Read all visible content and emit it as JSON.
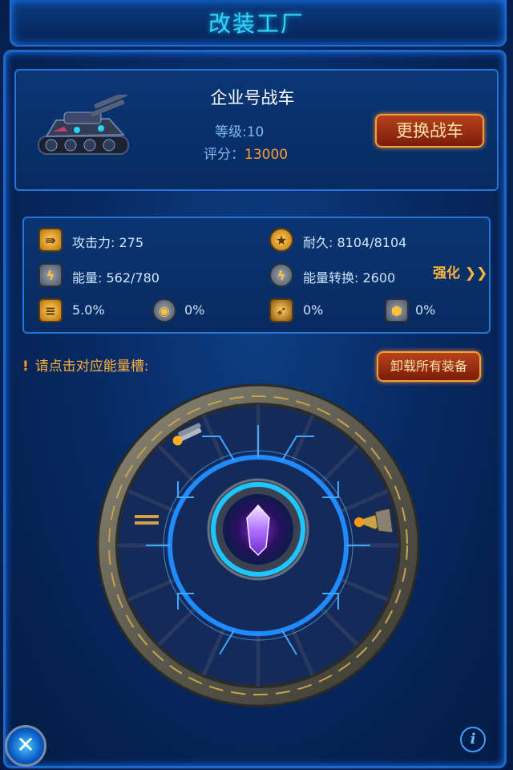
{
  "header": {
    "title": "改装工厂"
  },
  "vehicle": {
    "name": "企业号战车",
    "level_label": "等级:",
    "level_value": "10",
    "score_label": "评分：",
    "score_value": "13000",
    "change_button": "更换战车"
  },
  "stats": {
    "attack": "攻击力: 275",
    "durability": "耐久: 8104/8104",
    "energy": "能量: 562/780",
    "energy_conversion": "能量转换: 2600",
    "enhance_label": "强化",
    "enhance_arrows": "❯❯",
    "bonus_1": "5.0%",
    "bonus_2": "0%",
    "bonus_3": "0%",
    "bonus_4": "0%"
  },
  "prompt": {
    "mark": "!",
    "text": "请点击对应能量槽:"
  },
  "unload_button": "卸载所有装备",
  "controls": {
    "close_symbol": "✕",
    "info_symbol": "i"
  },
  "icons": [
    "attack-icon",
    "durability-icon",
    "energy-icon",
    "energy-conversion-icon",
    "ammo-icon",
    "target-icon",
    "missile-icon",
    "armor-icon",
    "energy-crystal-icon",
    "weapon-module-icon",
    "close-icon",
    "info-icon"
  ],
  "colors": {
    "title": "#37d7f4",
    "accent_orange": "#ffb33a",
    "panel_border": "#2475d8",
    "core_cyan": "#1ec6ff",
    "crystal": "#b070ff"
  }
}
